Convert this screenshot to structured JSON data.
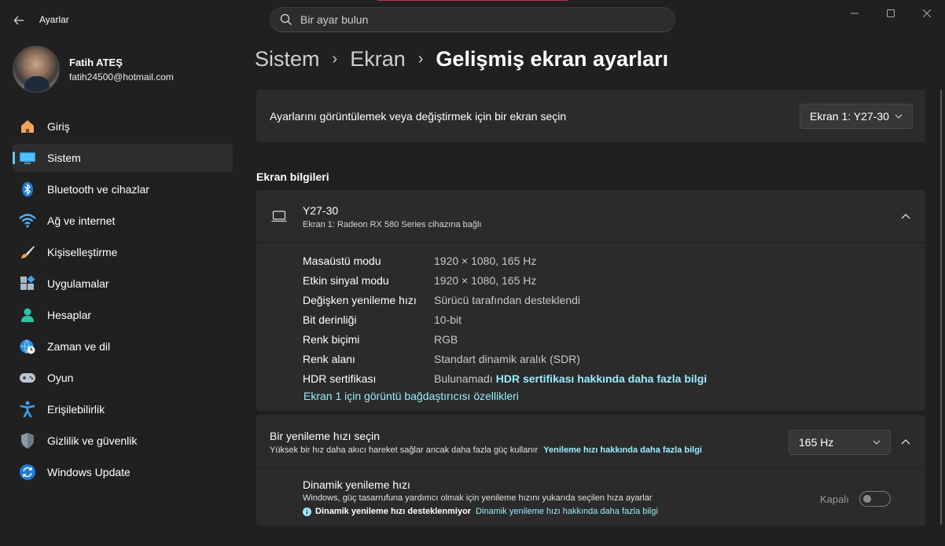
{
  "window": {
    "app_title": "Ayarlar",
    "search_placeholder": "Bir ayar bulun"
  },
  "profile": {
    "name": "Fatih ATEŞ",
    "email": "fatih24500@hotmail.com"
  },
  "sidebar": {
    "items": [
      {
        "label": "Giriş",
        "icon": "home-icon"
      },
      {
        "label": "Sistem",
        "icon": "system-icon",
        "active": true
      },
      {
        "label": "Bluetooth ve cihazlar",
        "icon": "bluetooth-icon"
      },
      {
        "label": "Ağ ve internet",
        "icon": "wifi-icon"
      },
      {
        "label": "Kişiselleştirme",
        "icon": "brush-icon"
      },
      {
        "label": "Uygulamalar",
        "icon": "apps-icon"
      },
      {
        "label": "Hesaplar",
        "icon": "account-icon"
      },
      {
        "label": "Zaman ve dil",
        "icon": "globe-clock-icon"
      },
      {
        "label": "Oyun",
        "icon": "gamepad-icon"
      },
      {
        "label": "Erişilebilirlik",
        "icon": "accessibility-icon"
      },
      {
        "label": "Gizlilik ve güvenlik",
        "icon": "shield-icon"
      },
      {
        "label": "Windows Update",
        "icon": "update-icon"
      }
    ]
  },
  "breadcrumb": {
    "level1": "Sistem",
    "level2": "Ekran",
    "current": "Gelişmiş ekran ayarları"
  },
  "display_select": {
    "label": "Ayarlarını görüntülemek veya değiştirmek için bir ekran seçin",
    "value": "Ekran 1: Y27-30"
  },
  "display_info": {
    "section_title": "Ekran bilgileri",
    "monitor_name": "Y27-30",
    "monitor_sub": "Ekran 1: Radeon RX 580 Series cihazına bağlı",
    "rows": [
      {
        "key": "Masaüstü modu",
        "value": "1920 × 1080, 165 Hz"
      },
      {
        "key": "Etkin sinyal modu",
        "value": "1920 × 1080, 165 Hz"
      },
      {
        "key": "Değişken yenileme hızı",
        "value": "Sürücü tarafından desteklendi"
      },
      {
        "key": "Bit derinliği",
        "value": "10-bit"
      },
      {
        "key": "Renk biçimi",
        "value": "RGB"
      },
      {
        "key": "Renk alanı",
        "value": "Standart dinamik aralık (SDR)"
      },
      {
        "key": "HDR sertifikası",
        "value": "Bulunamadı",
        "link": "HDR sertifikası hakkında daha fazla bilgi"
      }
    ],
    "adapter_link": "Ekran 1 için görüntü bağdaştırıcısı özellikleri"
  },
  "refresh_rate": {
    "title": "Bir yenileme hızı seçin",
    "subtitle": "Yüksek bir hız daha akıcı hareket sağlar ancak daha fazla güç kullanır",
    "link": "Yenileme hızı hakkında daha fazla bilgi",
    "value": "165 Hz"
  },
  "dynamic_refresh": {
    "title": "Dinamik yenileme hızı",
    "subtitle": "Windows, güç tasarrufuna yardımcı olmak için yenileme hızını yukarıda seçilen hıza ayarlar",
    "info": "Dinamik yenileme hızı desteklenmiyor",
    "link": "Dinamik yenileme hızı hakkında daha fazla bilgi",
    "toggle_label": "Kapalı"
  },
  "colors": {
    "accent": "#60cdff",
    "link": "#99ebff",
    "background": "#202020",
    "card": "#2b2b2b"
  }
}
